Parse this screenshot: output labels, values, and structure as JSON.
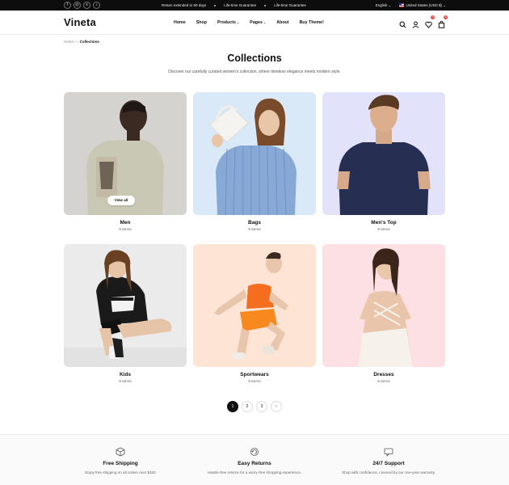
{
  "topbar": {
    "social": [
      "f",
      "◎",
      "x",
      "♪"
    ],
    "messages": [
      "Return extended to 60 days",
      "Life-time Guarantee",
      "Life-time Guarantee"
    ],
    "language": "English",
    "region": "United States (USD $)"
  },
  "header": {
    "logo": "Vineta",
    "nav": [
      "Home",
      "Shop",
      "Products",
      "Pages",
      "About",
      "Buy Theme!"
    ],
    "wishlist_count": "0",
    "cart_count": "0"
  },
  "breadcrumb": {
    "home": "Home",
    "sep": "/",
    "current": "Collections"
  },
  "page": {
    "title": "Collections",
    "subtitle": "Discover our carefully curated women's collection, where timeless elegance meets modern style."
  },
  "collections": [
    {
      "name": "Men",
      "count": "9 items",
      "view_all": "View all"
    },
    {
      "name": "Bags",
      "count": "9 items"
    },
    {
      "name": "Men's Top",
      "count": "9 items"
    },
    {
      "name": "Kids",
      "count": "9 items"
    },
    {
      "name": "Sportwears",
      "count": "9 items"
    },
    {
      "name": "Dresses",
      "count": "9 items"
    }
  ],
  "pagination": {
    "pages": [
      "1",
      "2",
      "3"
    ],
    "current": "1",
    "next": "›"
  },
  "features": [
    {
      "title": "Free Shipping",
      "desc": "Enjoy free shipping on all orders over $150"
    },
    {
      "title": "Easy Returns",
      "desc": "Hassle-free returns for a worry-free shopping experience."
    },
    {
      "title": "24/7 Support",
      "desc": "Shop with confidence, covered by our one-year warranty."
    }
  ],
  "colors": {
    "accent": "#111111",
    "badge": "#e8473e"
  },
  "icons": [
    "search-icon",
    "user-icon",
    "heart-icon",
    "bag-icon",
    "box-icon",
    "return-icon",
    "chat-icon"
  ]
}
